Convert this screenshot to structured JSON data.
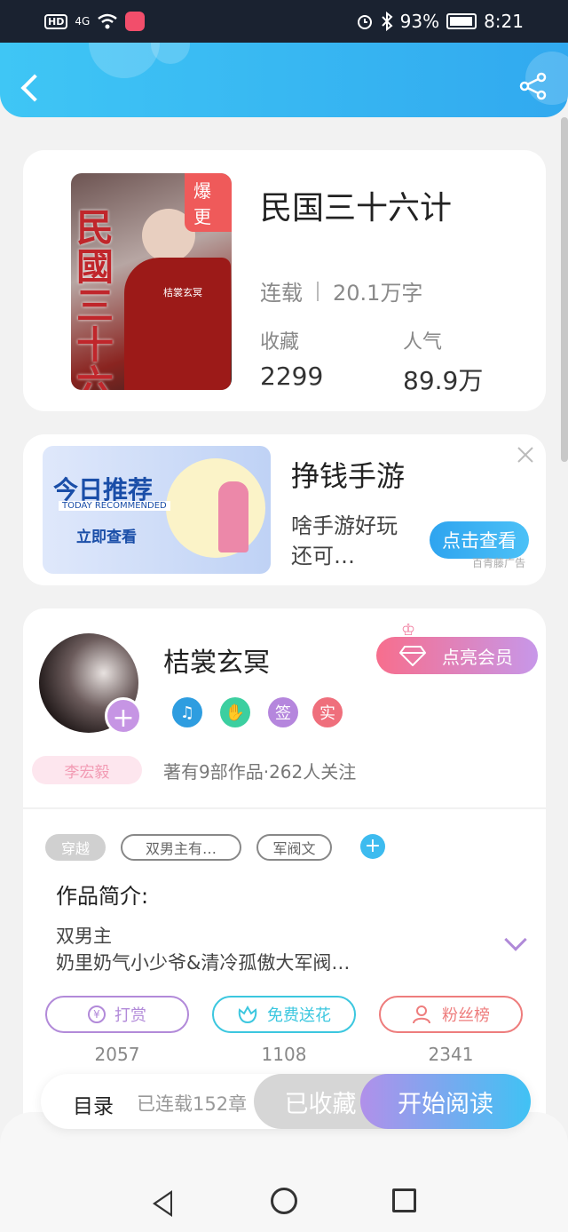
{
  "status_bar": {
    "network": "HD",
    "signal": "4G",
    "battery": "93%",
    "time": "8:21"
  },
  "header": {
    "back_icon": "back-arrow-icon",
    "share_icon": "share-icon"
  },
  "book": {
    "cover_title": "民國三十六計",
    "cover_author": "桔裳玄冥",
    "badge": "爆更",
    "title": "民国三十六计",
    "status": "连载",
    "word_count": "20.1万字",
    "favorites_label": "收藏",
    "favorites_value": "2299",
    "popularity_label": "人气",
    "popularity_value": "89.9万"
  },
  "ad": {
    "image_title": "今日推荐",
    "image_subtitle": "TODAY RECOMMENDED",
    "image_cta": "立即查看",
    "title": "挣钱手游",
    "description": "啥手游好玩还可…",
    "button": "点击查看",
    "source": "百青藤广告"
  },
  "author": {
    "name": "桔裳玄冥",
    "pen_tag": "李宏毅",
    "vip_button": "点亮会员",
    "badges": [
      "music-badge-icon",
      "handshake-badge-icon",
      "签",
      "实"
    ],
    "stats": "著有9部作品·262人关注"
  },
  "tags": [
    "穿越",
    "双男主有…",
    "军阀文"
  ],
  "intro": {
    "heading": "作品简介:",
    "line1": "双男主",
    "line2": "奶里奶气小少爷&清冷孤傲大军阀…"
  },
  "actions": [
    {
      "label": "打赏",
      "count": "2057",
      "color": "#b28ad9"
    },
    {
      "label": "免费送花",
      "count": "1108",
      "color": "#3cc7df"
    },
    {
      "label": "粉丝榜",
      "count": "2341",
      "color": "#ee7d7d"
    }
  ],
  "bottom_bar": {
    "toc": "目录",
    "toc_info": "已连载152章",
    "collected": "已收藏",
    "read": "开始阅读"
  }
}
